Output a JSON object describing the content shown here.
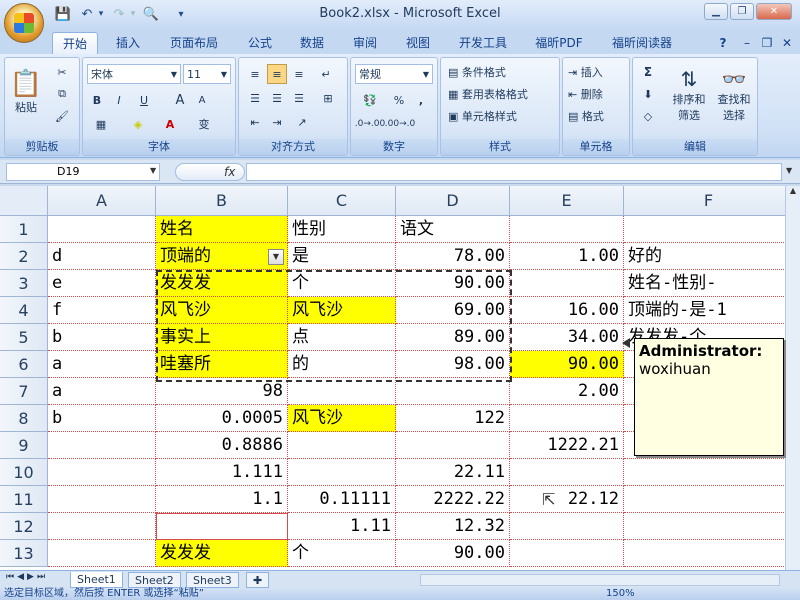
{
  "app": {
    "title": "Book2.xlsx - Microsoft Excel"
  },
  "quick_access": [
    "save-icon",
    "undo-icon",
    "redo-icon",
    "print-preview-icon"
  ],
  "tabs": [
    "开始",
    "插入",
    "页面布局",
    "公式",
    "数据",
    "审阅",
    "视图",
    "开发工具",
    "福昕PDF",
    "福昕阅读器"
  ],
  "ribbon": {
    "clipboard": {
      "paste": "粘贴",
      "label": "剪贴板"
    },
    "font": {
      "name": "宋体",
      "size": "11",
      "bold": "B",
      "italic": "I",
      "underline": "U",
      "grow": "A",
      "shrink": "A",
      "label": "字体"
    },
    "alignment": {
      "label": "对齐方式"
    },
    "number": {
      "format": "常规",
      "percent": "%",
      "comma": ",",
      "label": "数字"
    },
    "styles": {
      "conditional": "条件格式",
      "table": "套用表格格式",
      "cell": "单元格样式",
      "label": "样式"
    },
    "cells": {
      "insert": "插入",
      "delete": "删除",
      "format": "格式",
      "label": "单元格"
    },
    "editing": {
      "sum": "Σ",
      "sort": "排序和",
      "sort2": "筛选",
      "find": "查找和",
      "find2": "选择",
      "label": "编辑"
    }
  },
  "formula": {
    "namebox": "D19",
    "fx": "fx",
    "value": ""
  },
  "columns": [
    "A",
    "B",
    "C",
    "D",
    "E",
    "F"
  ],
  "rows": [
    {
      "n": "1",
      "A": "",
      "B": "姓名",
      "C": "性别",
      "D": "语文",
      "E": "",
      "F": ""
    },
    {
      "n": "2",
      "A": "d",
      "B": "顶端的",
      "C": "是",
      "D": "78.00",
      "E": "1.00",
      "F": "好的"
    },
    {
      "n": "3",
      "A": "e",
      "B": "发发发",
      "C": "个",
      "D": "90.00",
      "E": "",
      "F": "姓名-性别-"
    },
    {
      "n": "4",
      "A": "f",
      "B": "风飞沙",
      "C": "风飞沙",
      "D": "69.00",
      "E": "16.00",
      "F": "顶端的-是-1"
    },
    {
      "n": "5",
      "A": "b",
      "B": "事实上",
      "C": "点",
      "D": "89.00",
      "E": "34.00",
      "F": "发发发-个"
    },
    {
      "n": "6",
      "A": "a",
      "B": "哇塞所",
      "C": "的",
      "D": "98.00",
      "E": "90.00",
      "F": ""
    },
    {
      "n": "7",
      "A": "a",
      "B": "98",
      "C": "",
      "D": "",
      "E": "2.00",
      "F": ""
    },
    {
      "n": "8",
      "A": "b",
      "B": "0.0005",
      "C": "风飞沙",
      "D": "122",
      "E": "",
      "F": ""
    },
    {
      "n": "9",
      "A": "",
      "B": "0.8886",
      "C": "",
      "D": "",
      "E": "1222.21",
      "F": ""
    },
    {
      "n": "10",
      "A": "",
      "B": "1.111",
      "C": "",
      "D": "22.11",
      "E": "",
      "F": ""
    },
    {
      "n": "11",
      "A": "",
      "B": "1.1",
      "C": "0.11111",
      "D": "2222.22",
      "E": "22.12",
      "F": ""
    },
    {
      "n": "12",
      "A": "",
      "B": "",
      "C": "1.11",
      "D": "12.32",
      "E": "",
      "F": ""
    },
    {
      "n": "13",
      "A": "",
      "B": "发发发",
      "C": "个",
      "D": "90.00",
      "E": "",
      "F": ""
    }
  ],
  "comment": {
    "author": "Administrator:",
    "text": "woxihuan"
  },
  "sheets": [
    "Sheet1",
    "Sheet2",
    "Sheet3"
  ],
  "status": {
    "text": "选定目标区域，然后按 ENTER 或选择“粘贴”",
    "zoom": "150%"
  },
  "colors": {
    "highlight": "#ffff00",
    "gridline": "#d64b4b"
  }
}
